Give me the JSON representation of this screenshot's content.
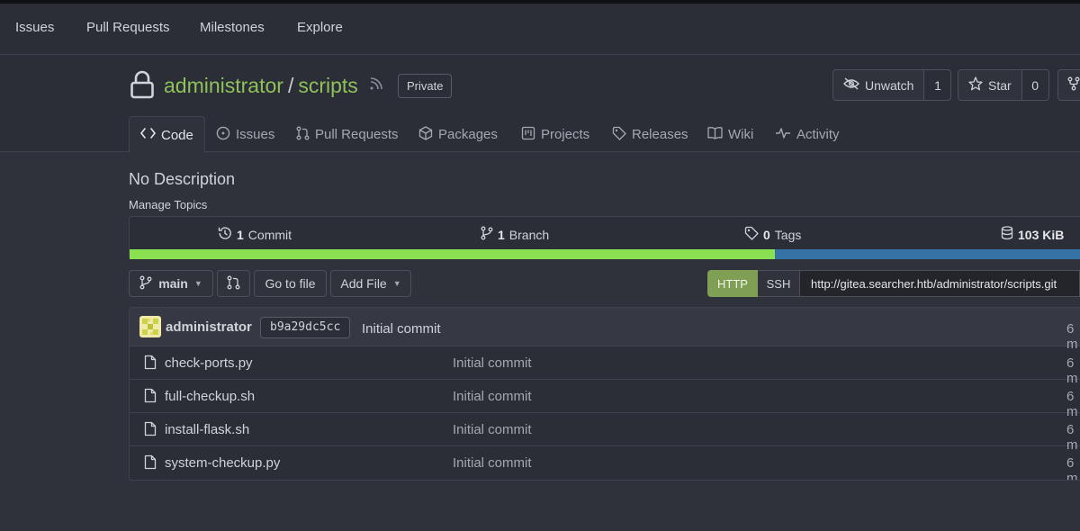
{
  "topnav": {
    "items": [
      {
        "label": "Issues"
      },
      {
        "label": "Pull Requests"
      },
      {
        "label": "Milestones"
      },
      {
        "label": "Explore"
      }
    ]
  },
  "repo": {
    "owner": "administrator",
    "separator": "/",
    "name": "scripts",
    "visibility": "Private",
    "watch_label": "Unwatch",
    "watch_count": "1",
    "star_label": "Star",
    "star_count": "0"
  },
  "tabs": [
    {
      "label": "Code",
      "icon": "code-icon",
      "active": true
    },
    {
      "label": "Issues",
      "icon": "issue-icon"
    },
    {
      "label": "Pull Requests",
      "icon": "pull-request-icon"
    },
    {
      "label": "Packages",
      "icon": "package-icon"
    },
    {
      "label": "Projects",
      "icon": "project-icon"
    },
    {
      "label": "Releases",
      "icon": "tag-icon"
    },
    {
      "label": "Wiki",
      "icon": "book-icon"
    },
    {
      "label": "Activity",
      "icon": "pulse-icon"
    }
  ],
  "description": "No Description",
  "manage_topics": "Manage Topics",
  "stats": {
    "commits_count": "1",
    "commits_label": "Commit",
    "branches_count": "1",
    "branches_label": "Branch",
    "tags_count": "0",
    "tags_label": "Tags",
    "size": "103 KiB"
  },
  "language_bar": [
    {
      "color": "#89e051",
      "fraction": 0.6765
    },
    {
      "color": "#3572a5",
      "fraction": 0.3235
    }
  ],
  "toolbar": {
    "branch": "main",
    "goto_file": "Go to file",
    "add_file": "Add File",
    "clone_http": "HTTP",
    "clone_ssh": "SSH",
    "clone_url": "http://gitea.searcher.htb/administrator/scripts.git"
  },
  "latest_commit": {
    "author": "administrator",
    "sha": "b9a29dc5cc",
    "message": "Initial commit",
    "time": "6 m"
  },
  "files": [
    {
      "name": "check-ports.py",
      "commit": "Initial commit",
      "time": "6 m"
    },
    {
      "name": "full-checkup.sh",
      "commit": "Initial commit",
      "time": "6 m"
    },
    {
      "name": "install-flask.sh",
      "commit": "Initial commit",
      "time": "6 m"
    },
    {
      "name": "system-checkup.py",
      "commit": "Initial commit",
      "time": "6 m"
    }
  ],
  "colors": {
    "accent_green": "#8fc15b",
    "http_button": "#7f9f55",
    "background": "#2f323b"
  }
}
